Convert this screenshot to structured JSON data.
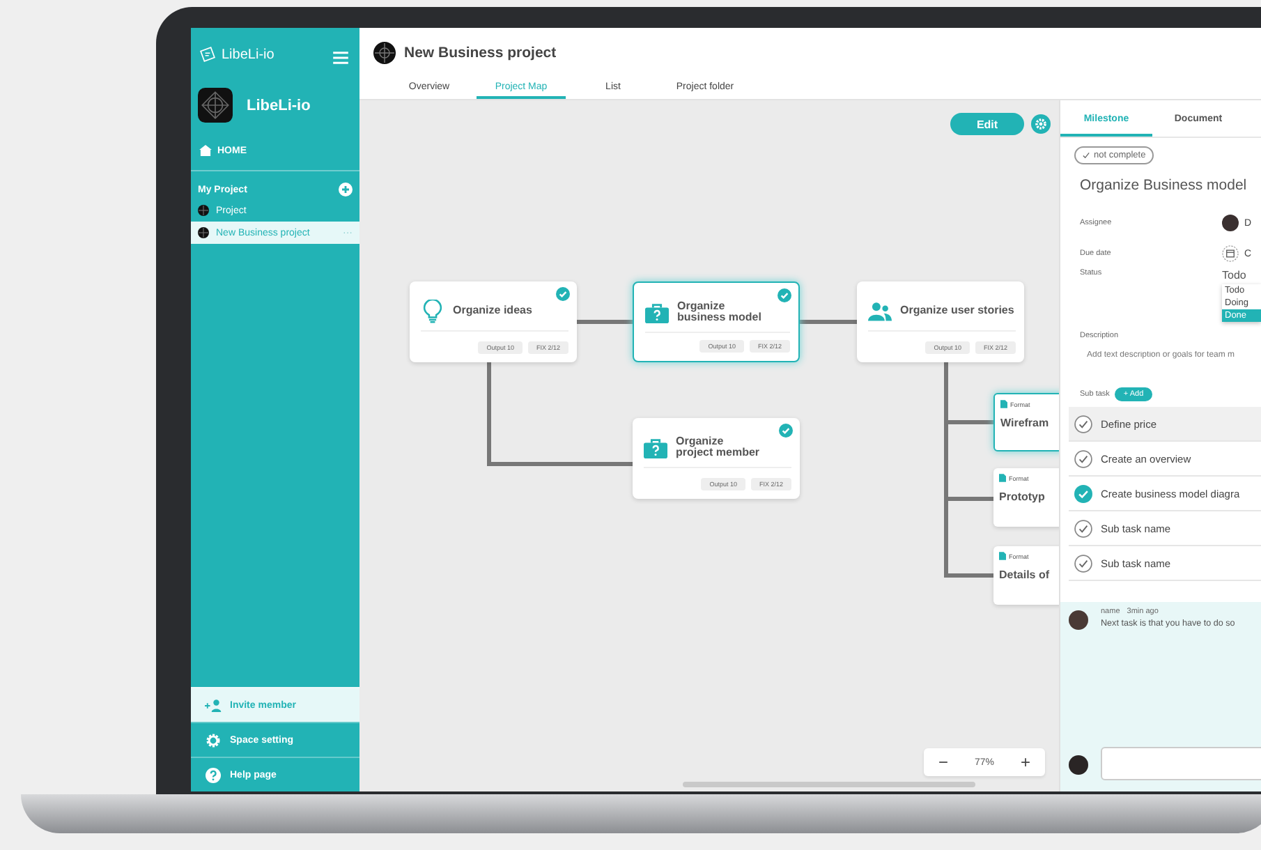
{
  "sidebar": {
    "brand": "LibeLi-io",
    "workspace": "LibeLi-io",
    "home": "HOME",
    "section": "My Project",
    "projects": [
      {
        "name": "Project",
        "selected": false
      },
      {
        "name": "New Business project",
        "selected": true,
        "more": "···"
      }
    ],
    "footer": [
      {
        "kind": "invite",
        "label": "Invite member",
        "selected": true
      },
      {
        "kind": "settings",
        "label": "Space setting",
        "selected": false
      },
      {
        "kind": "help",
        "label": "Help page",
        "selected": false
      }
    ]
  },
  "header": {
    "title": "New Business project",
    "tabs": [
      {
        "label": "Overview",
        "selected": false
      },
      {
        "label": "Project Map",
        "selected": true
      },
      {
        "label": "List",
        "selected": false
      },
      {
        "label": "Project folder",
        "selected": false
      }
    ]
  },
  "map": {
    "edit_button": "Edit",
    "nodes": [
      {
        "kind": "idea",
        "title": "Organize ideas",
        "output": "Output 10",
        "fix": "FIX 2/12",
        "done": true,
        "selected": false
      },
      {
        "kind": "business",
        "title": "Organize\nbusiness model",
        "output": "Output 10",
        "fix": "FIX 2/12",
        "done": true,
        "selected": true
      },
      {
        "kind": "people",
        "title": "Organize user stories",
        "output": "Output 10",
        "fix": "FIX 2/12",
        "done": false,
        "selected": false
      },
      {
        "kind": "business",
        "title": "Organize\nproject member",
        "output": "Output 10",
        "fix": "FIX 2/12",
        "done": true,
        "selected": false
      }
    ],
    "format_cards": [
      {
        "tag": "Format",
        "title": "Wirefram",
        "selected": true
      },
      {
        "tag": "Format",
        "title": "Prototyp",
        "selected": false
      },
      {
        "tag": "Format",
        "title": "Details of",
        "selected": false
      }
    ],
    "zoom": {
      "minus": "−",
      "value": "77%",
      "plus": "+"
    }
  },
  "panel": {
    "tabs": [
      {
        "label": "Milestone",
        "selected": true
      },
      {
        "label": "Document",
        "selected": false
      }
    ],
    "completion": {
      "label": "not complete",
      "checked": false
    },
    "title": "Organize Business model",
    "fields": [
      {
        "kind": "assignee",
        "label": "Assignee",
        "value": "D"
      },
      {
        "kind": "date",
        "label": "Due date",
        "value": "C"
      },
      {
        "kind": "status",
        "label": "Status",
        "value": "Todo",
        "options": [
          {
            "label": "Todo",
            "highlighted": false
          },
          {
            "label": "Doing",
            "highlighted": false
          },
          {
            "label": "Done",
            "highlighted": true
          }
        ]
      }
    ],
    "description": {
      "label": "Description",
      "placeholder": "Add text description or goals for team m"
    },
    "subtasks": {
      "label": "Sub task",
      "add_button": "+ Add",
      "items": [
        {
          "name": "Define price",
          "checked": false,
          "selected": true
        },
        {
          "name": "Create an overview",
          "checked": false,
          "selected": false
        },
        {
          "name": "Create business model diagra",
          "checked": true,
          "selected": false
        },
        {
          "name": "Sub task name",
          "checked": false,
          "selected": false
        },
        {
          "name": "Sub task name",
          "checked": false,
          "selected": false
        }
      ]
    },
    "comments": [
      {
        "author": "name",
        "time": "3min ago",
        "text": "Next task is that you have to do so"
      }
    ]
  }
}
